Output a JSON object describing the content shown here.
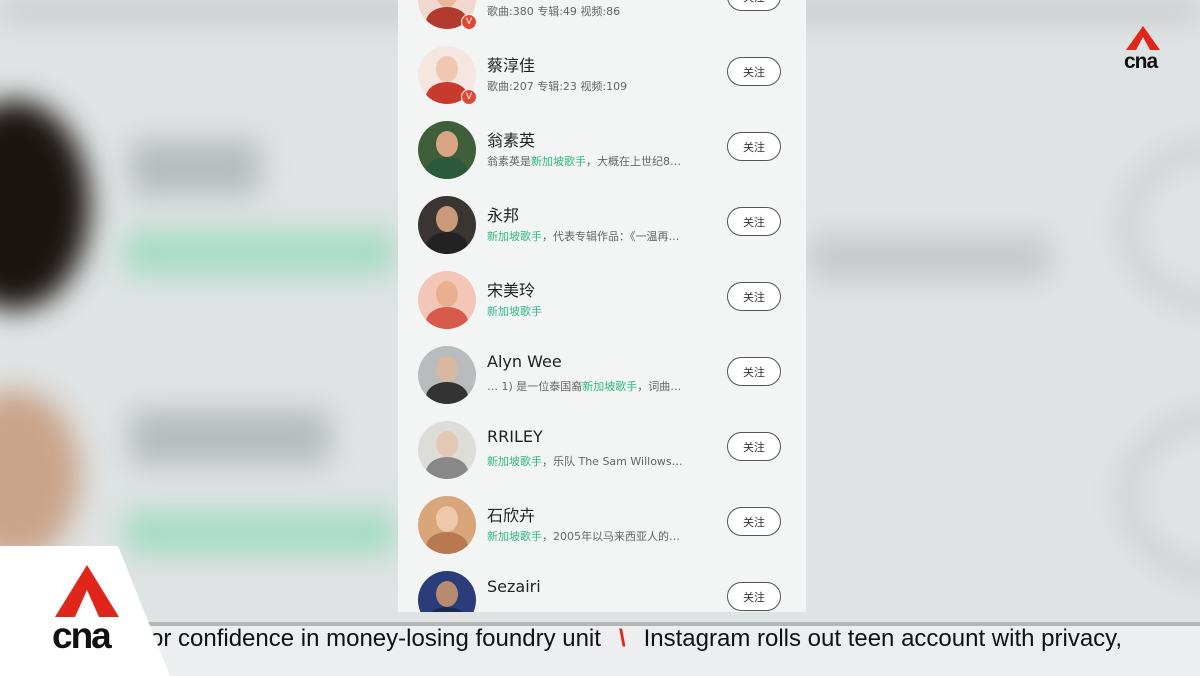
{
  "list": [
    {
      "name": "",
      "desc_pre": "歌曲:380  专辑:49  视频:86",
      "desc_hl": "",
      "desc_post": "",
      "verified": true,
      "follow": "关注",
      "face": "#e8b99a",
      "body": "#b33a2e",
      "bg": "#f2d9d0"
    },
    {
      "name": "蔡淳佳",
      "desc_pre": "歌曲:207  专辑:23  视频:109",
      "desc_hl": "",
      "desc_post": "",
      "verified": true,
      "follow": "关注",
      "face": "#f0c8b0",
      "body": "#c73a2c",
      "bg": "#f5e6e0"
    },
    {
      "name": "翁素英",
      "desc_pre": "翁素英是",
      "desc_hl": "新加坡歌手",
      "desc_post": "，大概在上世纪8…",
      "verified": false,
      "follow": "关注",
      "face": "#d9a585",
      "body": "#2a5a3a",
      "bg": "#3f5e3a"
    },
    {
      "name": "永邦",
      "desc_pre": "",
      "desc_hl": "新加坡歌手",
      "desc_post": "，代表专辑作品：《一温再…",
      "verified": false,
      "follow": "关注",
      "face": "#c89a7a",
      "body": "#222",
      "bg": "#3a3532"
    },
    {
      "name": "宋美玲",
      "desc_pre": "",
      "desc_hl": "新加坡歌手",
      "desc_post": "",
      "verified": false,
      "follow": "关注",
      "face": "#e8b090",
      "body": "#d85a4a",
      "bg": "#f3c6b8"
    },
    {
      "name": "Alyn Wee",
      "desc_pre": "… 1) 是一位泰国裔",
      "desc_hl": "新加坡歌手",
      "desc_post": "，词曲…",
      "verified": false,
      "follow": "关注",
      "face": "#d8b8a0",
      "body": "#333",
      "bg": "#b8bcbc"
    },
    {
      "name": "RRILEY",
      "desc_pre": "",
      "desc_hl": "新加坡歌手",
      "desc_post": "，乐队 The Sam Willows…",
      "verified": false,
      "follow": "关注",
      "face": "#e4c8b4",
      "body": "#888",
      "bg": "#dcdcd8"
    },
    {
      "name": "石欣卉",
      "desc_pre": "",
      "desc_hl": "新加坡歌手",
      "desc_post": "，2005年以马来西亚人的…",
      "verified": false,
      "follow": "关注",
      "face": "#eec8a8",
      "body": "#b87850",
      "bg": "#d8a67a"
    },
    {
      "name": "Sezairi",
      "desc_pre": "",
      "desc_hl": "",
      "desc_post": "",
      "verified": false,
      "follow": "关注",
      "face": "#b88a70",
      "body": "#1a2a55",
      "bg": "#2a3c7a"
    }
  ],
  "verified_badge": "V",
  "logo_top": "cna",
  "logo_bottom": "cna",
  "ticker": {
    "left": "or confidence in money-losing foundry unit",
    "separator": "\\",
    "right": "Instagram rolls out teen account with privacy,"
  },
  "colors": {
    "accent": "#e0261a",
    "highlight": "#2fb87e"
  }
}
